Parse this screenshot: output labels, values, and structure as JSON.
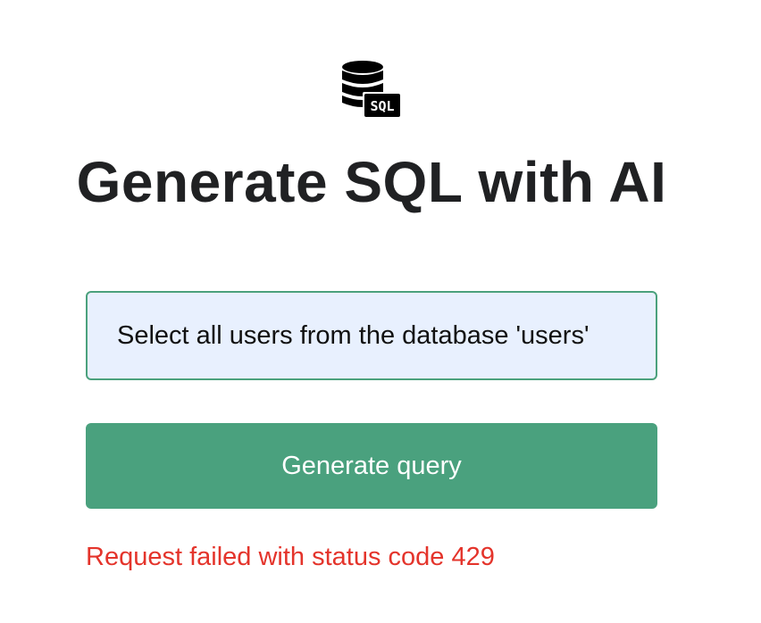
{
  "logo": {
    "icon": "database-sql-icon",
    "badge_text": "SQL"
  },
  "title": "Generate SQL with AI",
  "prompt_input": {
    "value": "Select all users from the database 'users'"
  },
  "generate_button": {
    "label": "Generate query",
    "color": "#4aa17e"
  },
  "error": {
    "message": "Request failed with status code 429",
    "color": "#e4342b"
  }
}
